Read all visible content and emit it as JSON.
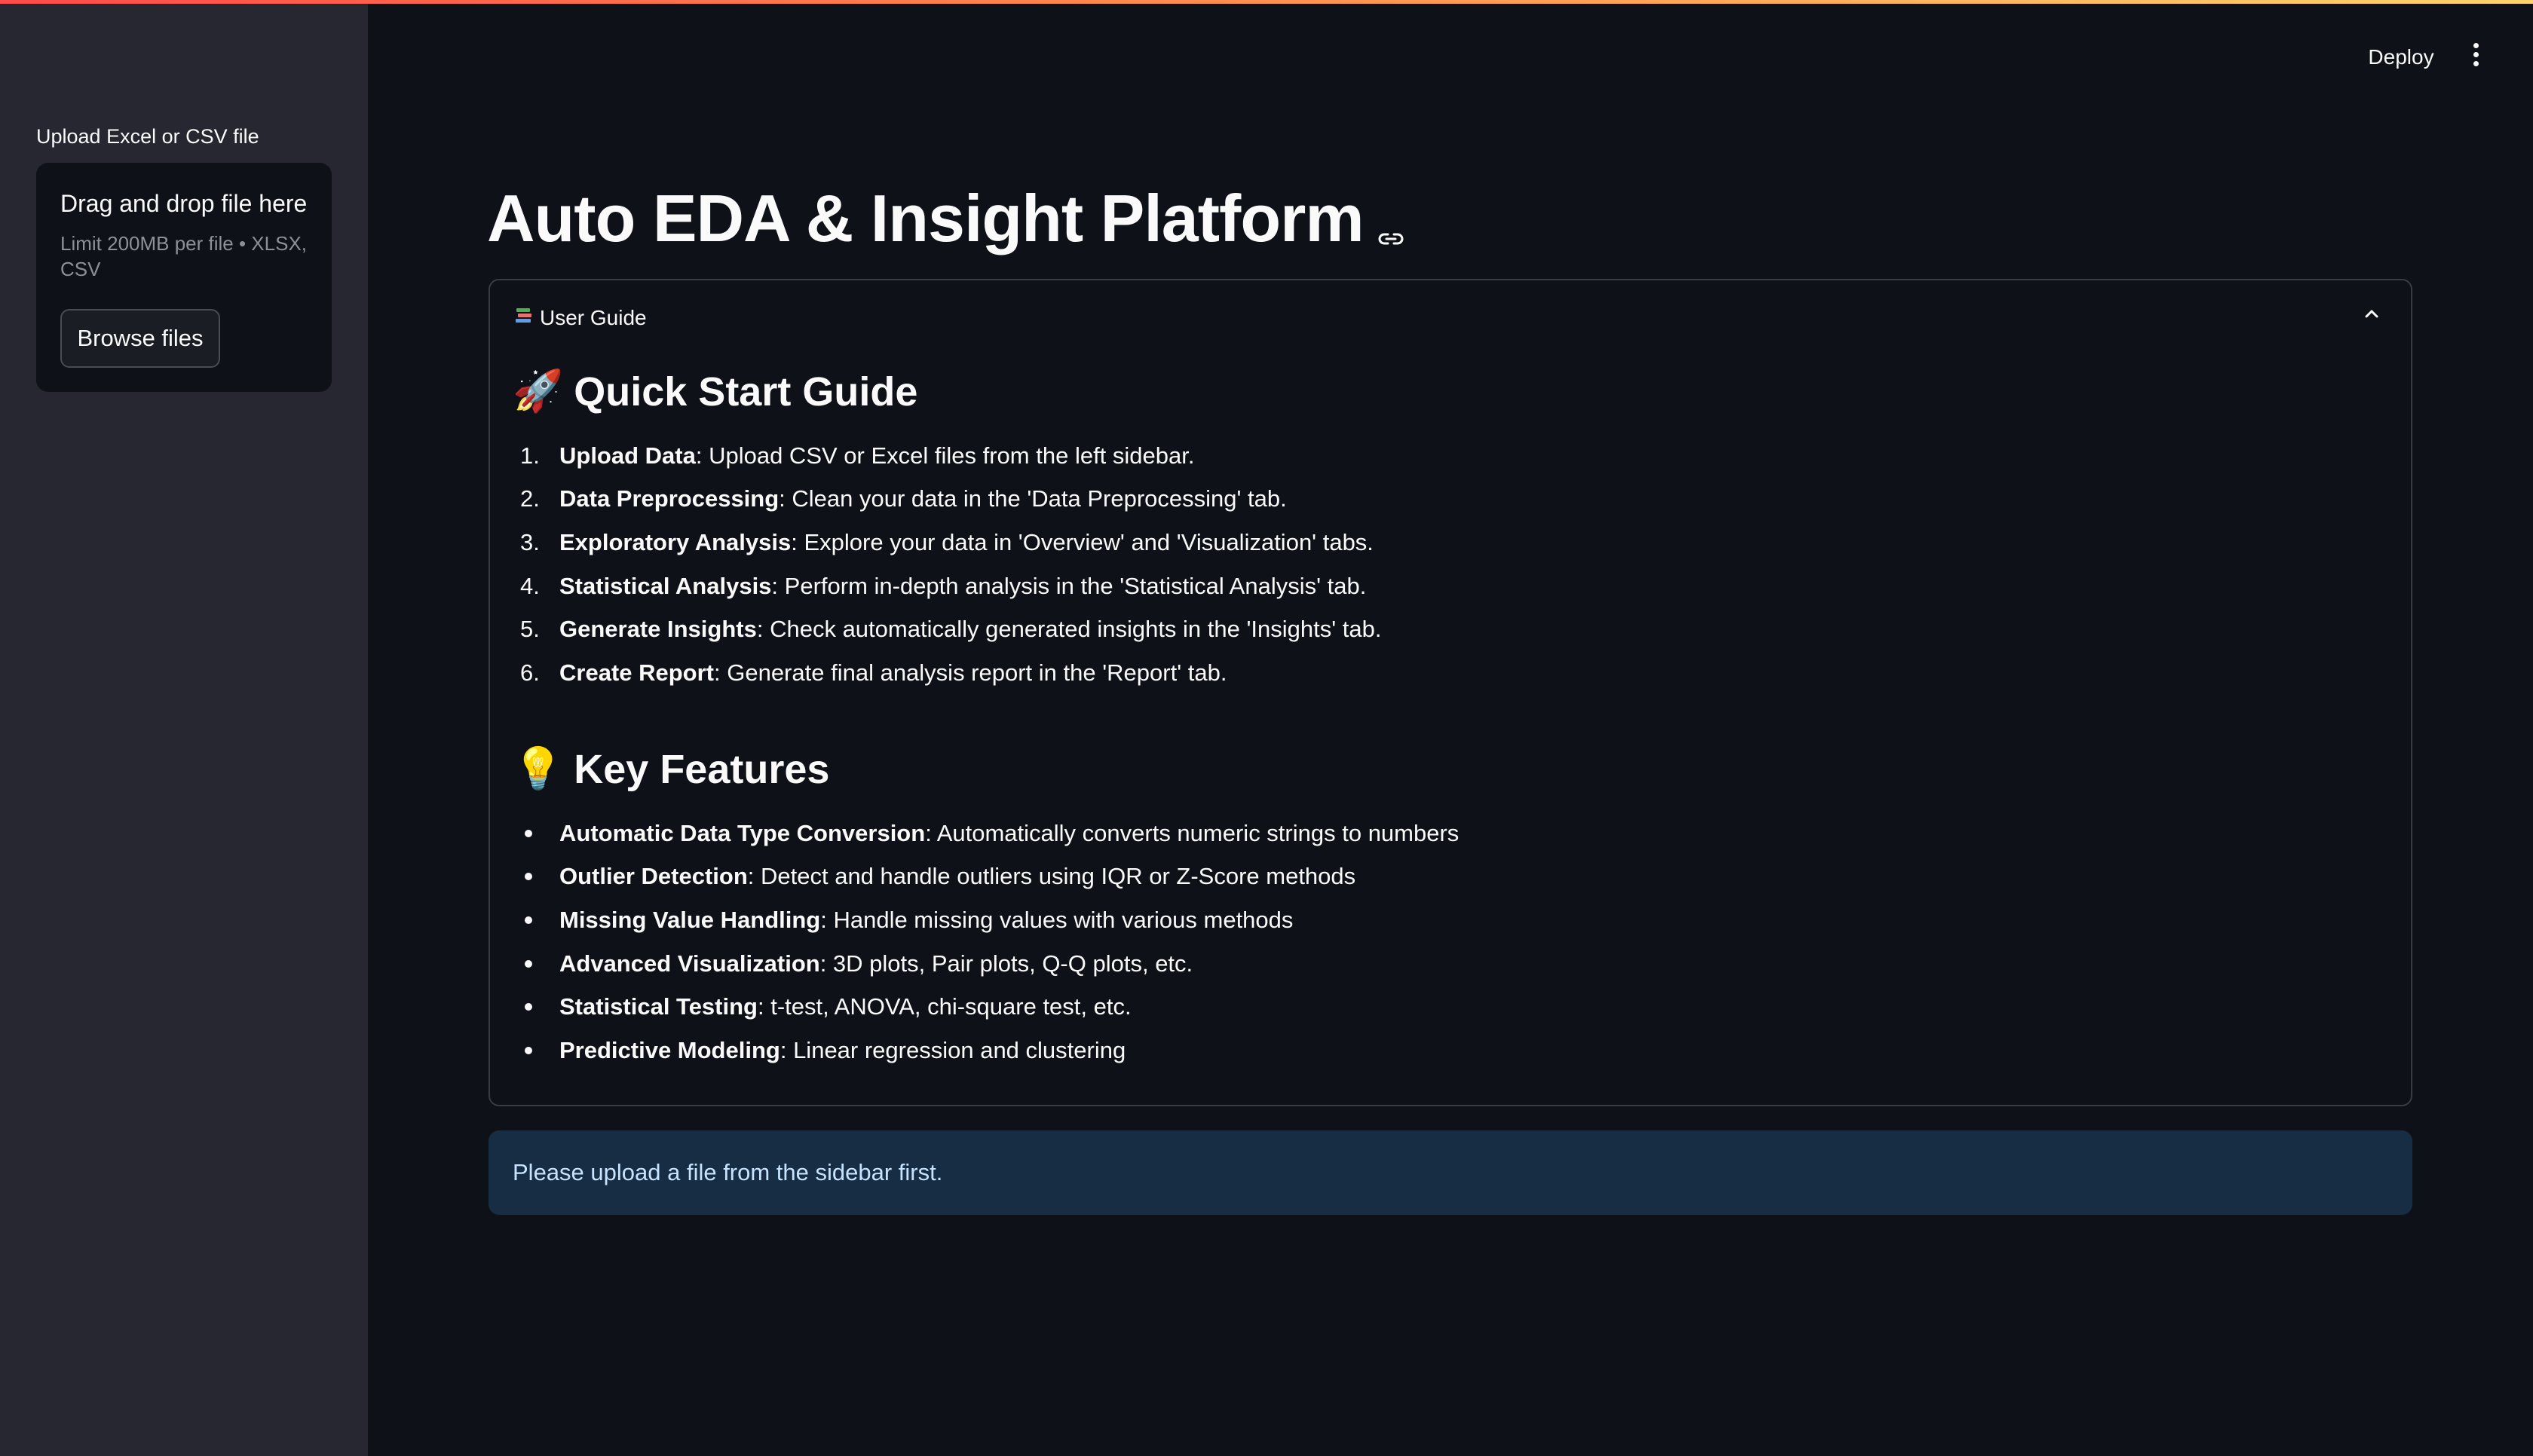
{
  "sidebar": {
    "uploader_label": "Upload Excel or CSV file",
    "dropzone_title": "Drag and drop file here",
    "dropzone_hint": "Limit 200MB per file • XLSX, CSV",
    "browse_label": "Browse files"
  },
  "header": {
    "deploy_label": "Deploy",
    "menu_icon": "kebab-vertical-icon"
  },
  "main": {
    "title": "Auto EDA & Insight Platform",
    "expander": {
      "label": "User Guide",
      "icon": "books-icon",
      "quick_start": {
        "heading": "Quick Start Guide",
        "emoji": "🚀",
        "steps": [
          {
            "num": "1.",
            "bold": "Upload Data",
            "text": ": Upload CSV or Excel files from the left sidebar."
          },
          {
            "num": "2.",
            "bold": "Data Preprocessing",
            "text": ": Clean your data in the 'Data Preprocessing' tab."
          },
          {
            "num": "3.",
            "bold": "Exploratory Analysis",
            "text": ": Explore your data in 'Overview' and 'Visualization' tabs."
          },
          {
            "num": "4.",
            "bold": "Statistical Analysis",
            "text": ": Perform in-depth analysis in the 'Statistical Analysis' tab."
          },
          {
            "num": "5.",
            "bold": "Generate Insights",
            "text": ": Check automatically generated insights in the 'Insights' tab."
          },
          {
            "num": "6.",
            "bold": "Create Report",
            "text": ": Generate final analysis report in the 'Report' tab."
          }
        ]
      },
      "features": {
        "heading": "Key Features",
        "emoji": "💡",
        "items": [
          {
            "bold": "Automatic Data Type Conversion",
            "text": ": Automatically converts numeric strings to numbers"
          },
          {
            "bold": "Outlier Detection",
            "text": ": Detect and handle outliers using IQR or Z-Score methods"
          },
          {
            "bold": "Missing Value Handling",
            "text": ": Handle missing values with various methods"
          },
          {
            "bold": "Advanced Visualization",
            "text": ": 3D plots, Pair plots, Q-Q plots, etc."
          },
          {
            "bold": "Statistical Testing",
            "text": ": t-test, ANOVA, chi-square test, etc."
          },
          {
            "bold": "Predictive Modeling",
            "text": ": Linear regression and clustering"
          }
        ]
      }
    },
    "info_message": "Please upload a file from the sidebar first."
  },
  "colors": {
    "background": "#0e1117",
    "sidebar": "#262730",
    "info_bg": "#172d43",
    "info_text": "#c7e3ff"
  }
}
